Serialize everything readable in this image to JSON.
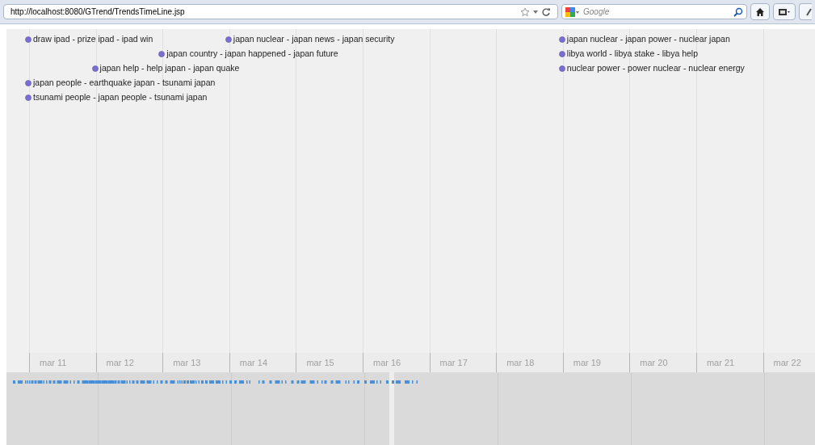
{
  "browser": {
    "url": "http://localhost:8080/GTrend/TrendsTimeLine.jsp",
    "search": {
      "placeholder": "Google"
    }
  },
  "days": [
    {
      "label": "mar 11",
      "events": [
        {
          "text": "draw ipad - prize ipad - ipad win"
        },
        {
          "text": "japan people - earthquake japan - tsunami japan"
        },
        {
          "text": "tsunami people - japan people - tsunami japan"
        }
      ]
    },
    {
      "label": "mar 12",
      "events": [
        {
          "text": "japan help - help japan - japan quake"
        }
      ]
    },
    {
      "label": "mar 13",
      "events": [
        {
          "text": "japan country - japan happened - japan future"
        }
      ]
    },
    {
      "label": "mar 14",
      "events": [
        {
          "text": "japan nuclear - japan news - japan security"
        }
      ]
    },
    {
      "label": "mar 15"
    },
    {
      "label": "mar 16"
    },
    {
      "label": "mar 17"
    },
    {
      "label": "mar 18"
    },
    {
      "label": "mar 19",
      "events": [
        {
          "text": "japan nuclear - japan power - nuclear japan"
        },
        {
          "text": "libya world - libya stake - libya help"
        },
        {
          "text": "nuclear power - power nuclear - nuclear energy"
        }
      ]
    },
    {
      "label": "mar 20"
    },
    {
      "label": "mar 21"
    },
    {
      "label": "mar 22"
    }
  ]
}
